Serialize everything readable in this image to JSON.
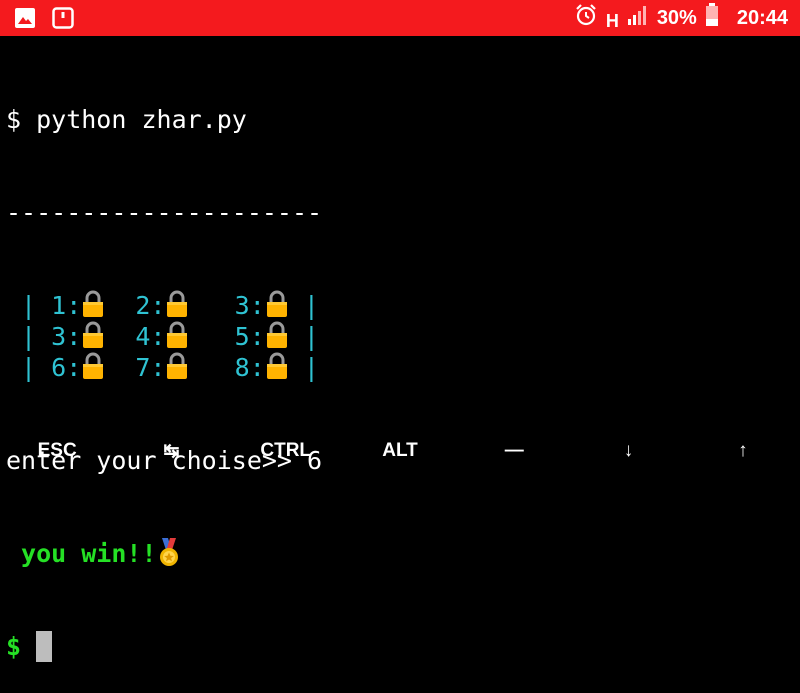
{
  "status_bar": {
    "network_letter": "H",
    "battery": "30%",
    "time": "20:44",
    "icons": [
      "gallery-icon",
      "notification-icon",
      "alarm-icon",
      "signal-icon",
      "battery-icon"
    ],
    "colors": {
      "background": "#f41a1e"
    }
  },
  "terminal": {
    "command_line": "$ python zhar.py",
    "separator": "---------------------",
    "grid": [
      {
        "prefix": " | ",
        "cells": [
          {
            "label": "1:",
            "gap": "  "
          },
          {
            "label": "2:",
            "gap": "   "
          },
          {
            "label": "3:",
            "gap": " "
          }
        ],
        "suffix": "|"
      },
      {
        "prefix": " | ",
        "cells": [
          {
            "label": "3:",
            "gap": "  "
          },
          {
            "label": "4:",
            "gap": "   "
          },
          {
            "label": "5:",
            "gap": " "
          }
        ],
        "suffix": "|"
      },
      {
        "prefix": " | ",
        "cells": [
          {
            "label": "6:",
            "gap": "  "
          },
          {
            "label": "7:",
            "gap": "   "
          },
          {
            "label": "8:",
            "gap": " "
          }
        ],
        "suffix": "|"
      }
    ],
    "prompt_text": "enter your choise>> 6",
    "result_text": " you win!!",
    "shell_prompt": "$ ",
    "colors": {
      "grid": "#2fc3d3",
      "win": "#25e025",
      "lock": "#ffb300",
      "cursor": "#bdbdbd"
    }
  },
  "extra_keys": [
    "ESC",
    "↹",
    "CTRL",
    "ALT",
    "—",
    "↓",
    "↑"
  ]
}
